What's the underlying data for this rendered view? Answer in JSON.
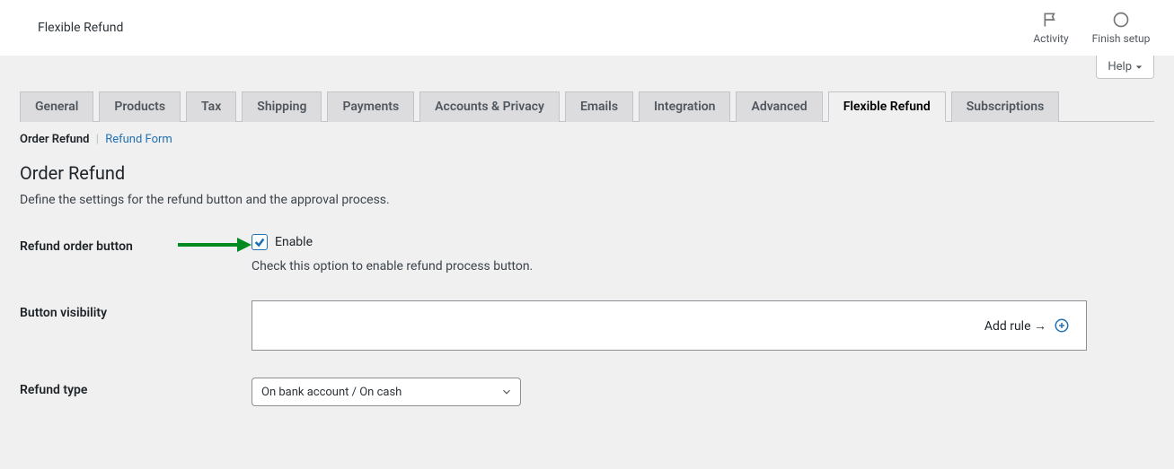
{
  "header": {
    "title": "Flexible Refund",
    "actions": {
      "activity": "Activity",
      "finish_setup": "Finish setup"
    }
  },
  "help_tab": "Help",
  "tabs": [
    "General",
    "Products",
    "Tax",
    "Shipping",
    "Payments",
    "Accounts & Privacy",
    "Emails",
    "Integration",
    "Advanced",
    "Flexible Refund",
    "Subscriptions"
  ],
  "active_tab_index": 9,
  "sub_nav": {
    "current": "Order Refund",
    "link": "Refund Form"
  },
  "section": {
    "title": "Order Refund",
    "desc": "Define the settings for the refund button and the approval process."
  },
  "fields": {
    "refund_order_button": {
      "label": "Refund order button",
      "checkbox_label": "Enable",
      "checked": true,
      "desc": "Check this option to enable refund process button."
    },
    "button_visibility": {
      "label": "Button visibility",
      "add_rule_text": "Add rule →"
    },
    "refund_type": {
      "label": "Refund type",
      "selected": "On bank account / On cash"
    }
  }
}
